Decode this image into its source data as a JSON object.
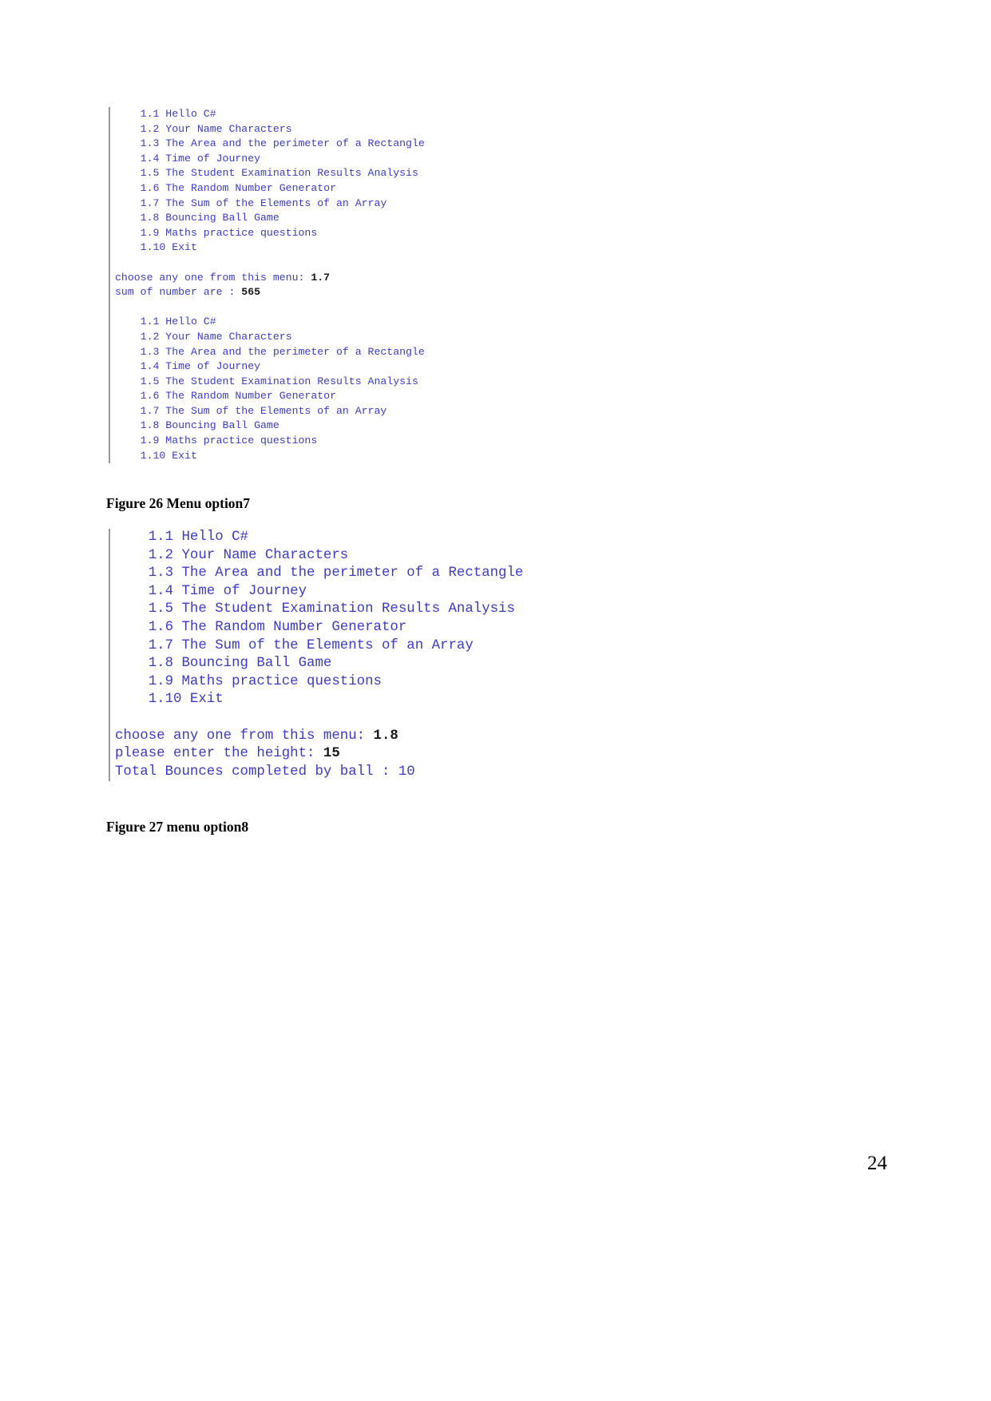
{
  "page": {
    "number": "24"
  },
  "figures": [
    {
      "caption": "Figure 26 Menu option7",
      "lines": [
        "    1.1 Hello C#",
        "    1.2 Your Name Characters",
        "    1.3 The Area and the perimeter of a Rectangle",
        "    1.4 Time of Journey",
        "    1.5 The Student Examination Results Analysis",
        "    1.6 The Random Number Generator",
        "    1.7 The Sum of the Elements of an Array",
        "    1.8 Bouncing Ball Game",
        "    1.9 Maths practice questions",
        "    1.10 Exit",
        "",
        "choose any one from this menu: 1.7",
        "sum of number are : 565",
        "",
        "    1.1 Hello C#",
        "    1.2 Your Name Characters",
        "    1.3 The Area and the perimeter of a Rectangle",
        "    1.4 Time of Journey",
        "    1.5 The Student Examination Results Analysis",
        "    1.6 The Random Number Generator",
        "    1.7 The Sum of the Elements of an Array",
        "    1.8 Bouncing Ball Game",
        "    1.9 Maths practice questions",
        "    1.10 Exit"
      ],
      "highlights": [
        {
          "line": 11,
          "prefix": "choose any one from this menu: ",
          "value": "1.7"
        },
        {
          "line": 12,
          "prefix": "sum of number are : ",
          "value": "565"
        }
      ]
    },
    {
      "caption": "Figure 27 menu option8",
      "lines": [
        "    1.1 Hello C#",
        "    1.2 Your Name Characters",
        "    1.3 The Area and the perimeter of a Rectangle",
        "    1.4 Time of Journey",
        "    1.5 The Student Examination Results Analysis",
        "    1.6 The Random Number Generator",
        "    1.7 The Sum of the Elements of an Array",
        "    1.8 Bouncing Ball Game",
        "    1.9 Maths practice questions",
        "    1.10 Exit",
        "",
        "choose any one from this menu: 1.8",
        "please enter the height: 15",
        "Total Bounces completed by ball : 10"
      ],
      "highlights": [
        {
          "line": 11,
          "prefix": "choose any one from this menu: ",
          "value": "1.8"
        },
        {
          "line": 12,
          "prefix": "please enter the height: ",
          "value": "15"
        }
      ]
    }
  ],
  "colors": {
    "console_text": "#3b3bc8",
    "input_value": "#18181c",
    "rule": "#9a9a9a",
    "caption": "#000000"
  }
}
